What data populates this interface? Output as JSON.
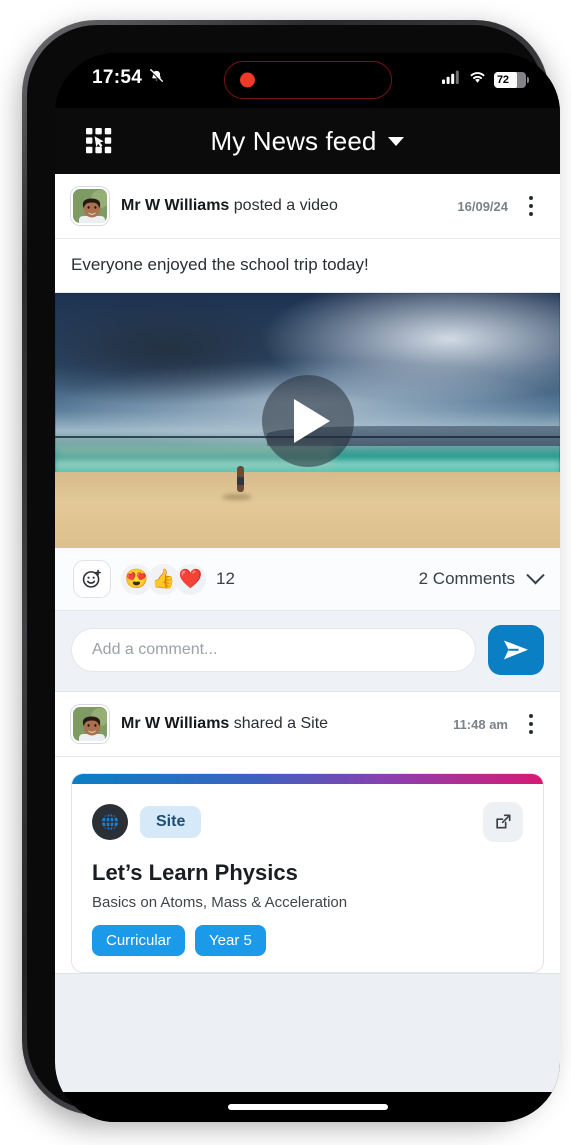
{
  "status_bar": {
    "time": "17:54",
    "silent_icon": "bell-slash-icon",
    "recording_icon": "record-dot-icon",
    "signal_icon": "cellular-signal-icon",
    "wifi_icon": "wifi-icon",
    "battery_percent": "72",
    "battery_level": 72
  },
  "header": {
    "apps_icon": "apps-grid-icon",
    "title": "My News feed",
    "dropdown_icon": "chevron-down-icon"
  },
  "feed": {
    "posts": [
      {
        "author": "Mr W Williams",
        "action": "posted a video",
        "time": "16/09/24",
        "menu_icon": "kebab-menu-icon",
        "text": "Everyone enjoyed the school trip today!",
        "media": {
          "type": "video",
          "play_icon": "play-icon",
          "description": "Beach with storm clouds and a person at the water's edge"
        },
        "reactions": {
          "add_icon": "add-reaction-icon",
          "emojis": [
            "😍",
            "👍",
            "❤️"
          ],
          "count": "12",
          "comments_label": "2 Comments",
          "comments_chevron": "chevron-down-icon"
        },
        "composer": {
          "placeholder": "Add a comment...",
          "value": "",
          "send_icon": "send-icon"
        }
      },
      {
        "author": "Mr W Williams",
        "action": "shared a Site",
        "time": "11:48 am",
        "menu_icon": "kebab-menu-icon",
        "card": {
          "type_icon": "globe-icon",
          "type_badge": "Site",
          "open_icon": "external-link-icon",
          "title": "Let’s Learn Physics",
          "subtitle": "Basics on Atoms, Mass & Acceleration",
          "tags": [
            "Curricular",
            "Year 5"
          ]
        }
      }
    ]
  },
  "home_indicator": "home-bar"
}
